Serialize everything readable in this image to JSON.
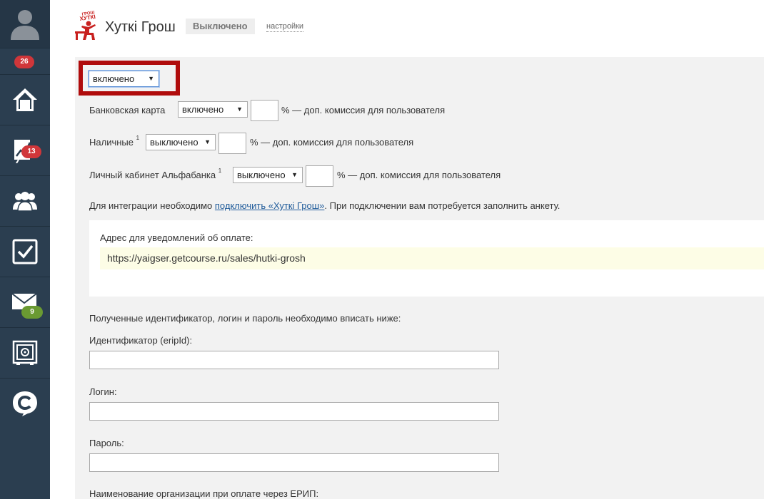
{
  "sidebar": {
    "counter_badge": "26",
    "items": [
      {
        "icon": "home-icon"
      },
      {
        "icon": "chart-icon",
        "badge": "13"
      },
      {
        "icon": "users-icon"
      },
      {
        "icon": "tasks-checkbox-icon"
      },
      {
        "icon": "mail-icon",
        "badge": "9"
      },
      {
        "icon": "safe-icon"
      },
      {
        "icon": "getcourse-logo-icon"
      }
    ]
  },
  "header": {
    "logo_text": "ХУТКІ",
    "title": "Хуткі Грош",
    "status": "Выключено",
    "settings_link": "настройки"
  },
  "form": {
    "main_toggle": "включено",
    "rows": [
      {
        "label": "Банковская карта",
        "sup": "",
        "value": "включено",
        "suffix": "% — доп. комиссия для пользователя"
      },
      {
        "label": "Наличные",
        "sup": "1",
        "value": "выключено",
        "suffix": "% — доп. комиссия для пользователя"
      },
      {
        "label": "Личный кабинет Альфабанка",
        "sup": "1",
        "value": "выключено",
        "suffix": "% — доп. комиссия для пользователя"
      }
    ],
    "integration_prefix": "Для интеграции необходимо ",
    "integration_link": "подключить «Хуткі Грош»",
    "integration_suffix": ". При подключении вам потребуется заполнить анкету.",
    "notify_label": "Адрес для уведомлений об оплате:",
    "notify_url": "https://yaigser.getcourse.ru/sales/hutki-grosh",
    "credentials_hint": "Полученные идентификатор, логин и пароль необходимо вписать ниже:",
    "id_label": "Идентификатор (eripId):",
    "login_label": "Логин:",
    "password_label": "Пароль:",
    "org_label": "Наименование организации при оплате через ЕРИП:"
  },
  "colors": {
    "sidebar_bg": "#2b3e50",
    "highlight": "#b00c0c",
    "badge_red": "#d0363a",
    "badge_green": "#6a9a32",
    "link": "#1f5b9a"
  }
}
